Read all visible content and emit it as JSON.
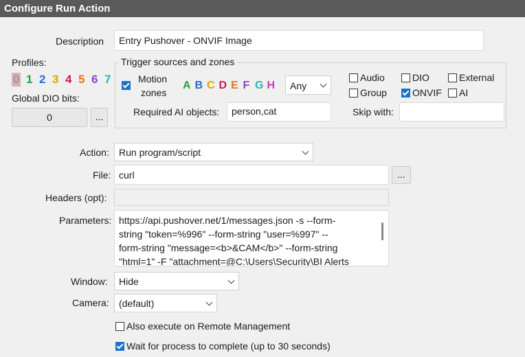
{
  "window": {
    "title": "Configure Run Action"
  },
  "description": {
    "label": "Description",
    "value": "Entry Pushover - ONVIF Image"
  },
  "profiles": {
    "label": "Profiles:",
    "digits": [
      {
        "text": "0",
        "color": "#9a9a9a"
      },
      {
        "text": "1",
        "color": "#2e9e3e"
      },
      {
        "text": "2",
        "color": "#1f6fd0"
      },
      {
        "text": "3",
        "color": "#d6a800"
      },
      {
        "text": "4",
        "color": "#d4145a"
      },
      {
        "text": "5",
        "color": "#e07a1a"
      },
      {
        "text": "6",
        "color": "#8a44c8"
      },
      {
        "text": "7",
        "color": "#2bb3b3"
      }
    ]
  },
  "global_dio": {
    "label": "Global DIO bits:",
    "value": "0",
    "button": "..."
  },
  "trigger": {
    "title": "Trigger sources and zones",
    "motion_label_1": "Motion",
    "motion_label_2": "zones",
    "motion_checked": true,
    "zones": [
      {
        "text": "A",
        "color": "#2e9e3e"
      },
      {
        "text": "B",
        "color": "#1f6fd0"
      },
      {
        "text": "C",
        "color": "#d6a800"
      },
      {
        "text": "D",
        "color": "#d4145a"
      },
      {
        "text": "E",
        "color": "#e07a1a"
      },
      {
        "text": "F",
        "color": "#8a44c8"
      },
      {
        "text": "G",
        "color": "#2bb3b3"
      },
      {
        "text": "H",
        "color": "#c83cc8"
      }
    ],
    "zone_mode": "Any",
    "audio": {
      "label": "Audio",
      "checked": false
    },
    "dio": {
      "label": "DIO",
      "checked": false
    },
    "external": {
      "label": "External",
      "checked": false
    },
    "group": {
      "label": "Group",
      "checked": false
    },
    "onvif": {
      "label": "ONVIF",
      "checked": true
    },
    "ai": {
      "label": "AI",
      "checked": false
    },
    "required_ai_label": "Required AI objects:",
    "required_ai_value": "person,cat",
    "skip_label": "Skip with:",
    "skip_value": ""
  },
  "action": {
    "label": "Action:",
    "value": "Run program/script"
  },
  "file": {
    "label": "File:",
    "value": "curl",
    "button": "..."
  },
  "headers": {
    "label": "Headers (opt):",
    "value": ""
  },
  "parameters": {
    "label": "Parameters:",
    "lines": [
      "https://api.pushover.net/1/messages.json -s --form-",
      "string \"token=%996\" --form-string \"user=%997\" --",
      "form-string \"message=<b>&CAM</b>\" --form-string",
      "\"html=1\" -F \"attachment=@C:\\Users\\Security\\BI Alerts"
    ]
  },
  "window_mode": {
    "label": "Window:",
    "value": "Hide"
  },
  "camera": {
    "label": "Camera:",
    "value": "(default)"
  },
  "remote": {
    "label": "Also execute on Remote Management",
    "checked": false
  },
  "wait": {
    "label": "Wait for process to complete (up to 30 seconds)",
    "checked": true
  }
}
